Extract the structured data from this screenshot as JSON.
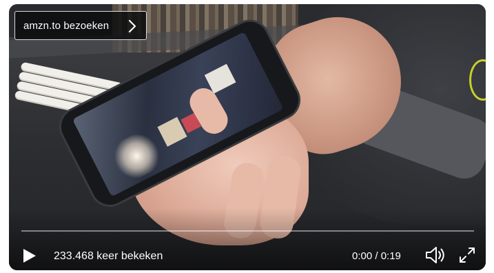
{
  "player": {
    "link": {
      "label": "amzn.to bezoeken",
      "icon": "chevron-right-icon"
    },
    "views_label": "233.468 keer bekeken",
    "time_label": "0:00 / 0:19",
    "progress": 0.0,
    "icons": {
      "play": "play-icon",
      "volume": "volume-icon",
      "fullscreen": "fullscreen-expand-icon"
    },
    "colors": {
      "controls": "#ffffff",
      "link_background": "#0a0c0e"
    }
  }
}
